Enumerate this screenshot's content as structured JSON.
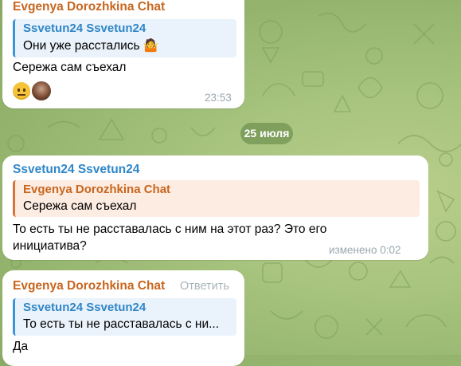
{
  "messages": [
    {
      "sender": "Evgenya Dorozhkina Chat",
      "reply": {
        "name": "Ssvetun24 Ssvetun24",
        "text": "Они уже расстались 🤷"
      },
      "text": "Сережа сам съехал",
      "reactions": [
        "neutral-face-emoji",
        "user-avatar"
      ],
      "time": "23:53"
    },
    {
      "sender": "Ssvetun24 Ssvetun24",
      "reply": {
        "name": "Evgenya Dorozhkina Chat",
        "text": "Сережа сам съехал"
      },
      "text": "То есть ты не расставалась с ним на этот раз? Это его инициатива?",
      "time": "изменено 0:02"
    },
    {
      "sender": "Evgenya Dorozhkina Chat",
      "action": "Ответить",
      "reply": {
        "name": "Ssvetun24 Ssvetun24",
        "text": "То есть ты не расставалась с ни..."
      },
      "text": "Да"
    }
  ],
  "date_separator": "25 июля",
  "colors": {
    "sender_orange": "#c8661f",
    "sender_blue": "#2f86c8",
    "accent": "#3e95d6"
  }
}
